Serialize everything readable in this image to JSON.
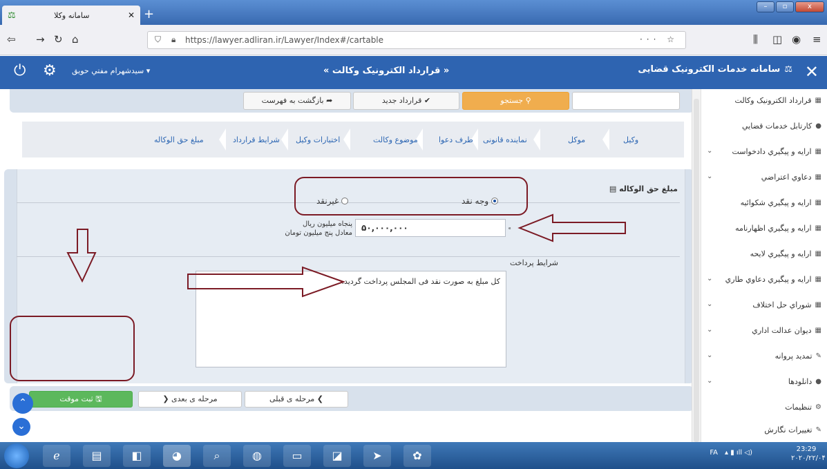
{
  "browser": {
    "tab_title": "سامانه وکلا",
    "url": "https://lawyer.adliran.ir/Lawyer/Index#/cartable",
    "url_tools": "···  ☆"
  },
  "header": {
    "close": "✕",
    "brand": "سامانه خدمات الکترونیک قضایی",
    "center_title": "« قرارداد الکترونیک وکالت »",
    "user": "سیدشهرام مفتي حويق"
  },
  "toolbar": {
    "search_label": "جستجو",
    "new_contract_label": "✔ قرارداد جدید",
    "back_label": "بازگشت به فهرست"
  },
  "steps": [
    {
      "label": "وکیل",
      "link": true
    },
    {
      "label": "موکل",
      "link": true
    },
    {
      "label": "نماینده قانونی",
      "link": true
    },
    {
      "label": "طرف دعوا",
      "link": true
    },
    {
      "label": "موضوع وکالت",
      "link": true
    },
    {
      "label": "اختیارات وکیل",
      "link": true
    },
    {
      "label": "شرایط قرارداد",
      "link": true
    },
    {
      "label": "مبلغ حق الوکاله",
      "link": true
    }
  ],
  "form": {
    "panel_title": "مبلغ حق الوکاله",
    "radio_cash": "وجه نقد",
    "radio_noncash": "غیرنقد",
    "amount_value": "۵۰,۰۰۰,۰۰۰",
    "amount_words_line1": "پنجاه میلیون ریال",
    "amount_words_line2": "معادل پنج میلیون تومان",
    "terms_label": "شرایط پرداخت",
    "terms_value": "کل مبلغ به صورت نقد فی المجلس پرداخت گردید."
  },
  "footer": {
    "save_label": "ثبت موقت",
    "next_label": "مرحله ی بعدی",
    "prev_label": "مرحله ی قبلی"
  },
  "sidebar": {
    "items": [
      {
        "label": "قرارداد الکترونیک وکالت",
        "chevron": false
      },
      {
        "label": "کارتابل خدمات قضايي",
        "chevron": false
      },
      {
        "label": "ارايه و پيگيري دادخواست",
        "chevron": true
      },
      {
        "label": "دعاوي اعتراضي",
        "chevron": true
      },
      {
        "label": "ارايه و پيگيري شکوائيه",
        "chevron": false
      },
      {
        "label": "ارايه و پيگيري اظهارنامه",
        "chevron": false
      },
      {
        "label": "ارايه و پيگيري لايحه",
        "chevron": false
      },
      {
        "label": "ارايه و پيگيري دعاوي طاري",
        "chevron": true
      },
      {
        "label": "شوراي حل اختلاف",
        "chevron": true
      },
      {
        "label": "ديوان عدالت اداري",
        "chevron": true
      },
      {
        "label": "تمديد پروانه",
        "chevron": true
      },
      {
        "label": "دانلودها",
        "chevron": true
      },
      {
        "label": "تنظيمات",
        "chevron": false
      },
      {
        "label": "تغييرات نگارش",
        "chevron": false
      }
    ]
  },
  "taskbar": {
    "lang": "FA",
    "time": "23:29",
    "date": "۲۰۲۰/۲۲/۰۴"
  }
}
